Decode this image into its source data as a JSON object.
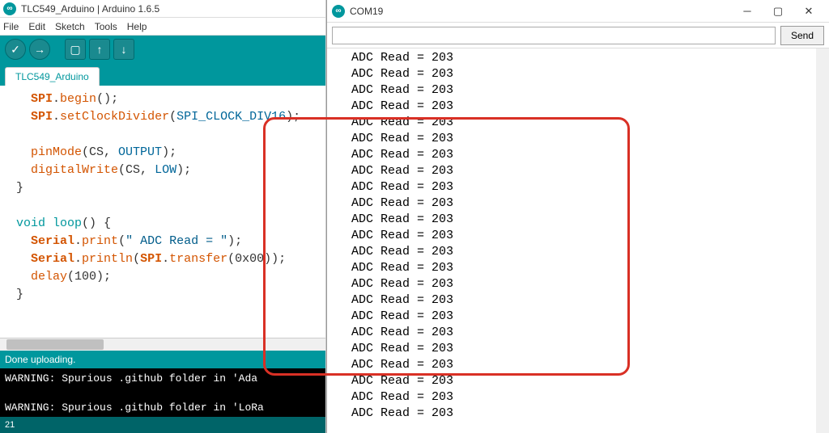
{
  "ide": {
    "title": "TLC549_Arduino | Arduino 1.6.5",
    "menu": [
      "File",
      "Edit",
      "Sketch",
      "Tools",
      "Help"
    ],
    "tab": "TLC549_Arduino",
    "status": "Done uploading.",
    "footer_line": "21",
    "console_lines": [
      "WARNING: Spurious .github folder in 'Ada",
      "",
      "WARNING: Spurious .github folder in 'LoRa"
    ],
    "code": {
      "l1a": "SPI",
      "l1b": ".",
      "l1c": "begin",
      "l1d": "();",
      "l2a": "SPI",
      "l2b": ".",
      "l2c": "setClockDivider",
      "l2d": "(",
      "l2e": "SPI_CLOCK_DIV16",
      "l2f": ");",
      "l4a": "pinMode",
      "l4b": "(CS, ",
      "l4c": "OUTPUT",
      "l4d": ");",
      "l5a": "digitalWrite",
      "l5b": "(CS, ",
      "l5c": "LOW",
      "l5d": ");",
      "l6": "}",
      "l8a": "void",
      "l8b": " ",
      "l8c": "loop",
      "l8d": "() {",
      "l9a": "Serial",
      "l9b": ".",
      "l9c": "print",
      "l9d": "(",
      "l9e": "\" ADC Read = \"",
      "l9f": ");",
      "l10a": "Serial",
      "l10b": ".",
      "l10c": "println",
      "l10d": "(",
      "l10e": "SPI",
      "l10f": ".",
      "l10g": "transfer",
      "l10h": "(0x00));",
      "l11a": "delay",
      "l11b": "(100);",
      "l12": "}"
    }
  },
  "serial": {
    "title": "COM19",
    "send_label": "Send",
    "adc_prefix": " ADC Read = ",
    "adc_value": "203",
    "line_count": 23
  }
}
